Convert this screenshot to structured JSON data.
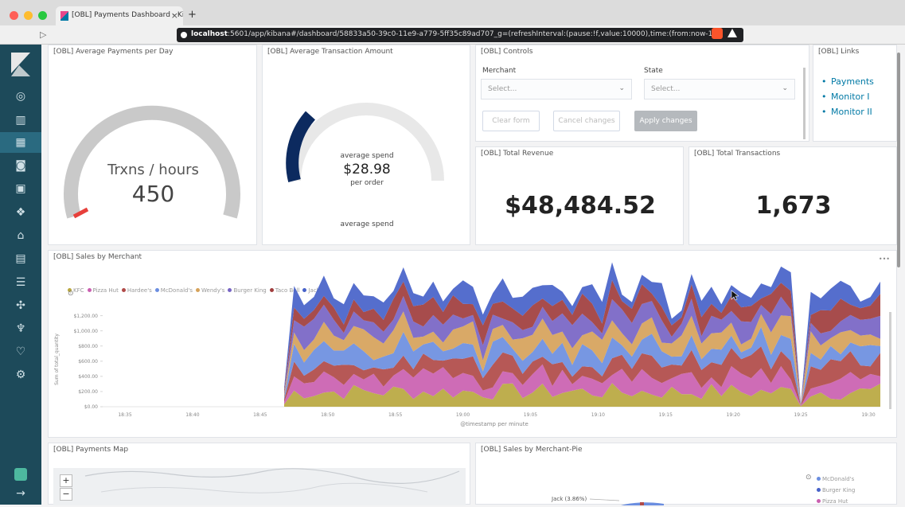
{
  "browser": {
    "tab_title": "[OBL] Payments Dashboard - Ki",
    "url_host": "localhost",
    "url_rest": ":5601/app/kibana#/dashboard/58833a50-39c0-11e9-a779-5ff35c89ad707_g=(refreshInterval:(pause:!f,value:10000),time:(from:now-1...",
    "tab_close": "×",
    "new_tab": "+",
    "back": "▷"
  },
  "panels": {
    "avg_payments": {
      "title": "[OBL] Average Payments per Day",
      "label": "Trxns / hours",
      "value": "450",
      "gauge_fraction": 0.0
    },
    "avg_txn": {
      "title": "[OBL] Average Transaction Amount",
      "top_label": "average spend",
      "value": "$28.98",
      "sub_label": "per order",
      "bottom_label": "average spend",
      "gauge_fraction": 0.12
    },
    "controls": {
      "title": "[OBL] Controls",
      "merchant_label": "Merchant",
      "merchant_placeholder": "Select...",
      "state_label": "State",
      "state_placeholder": "Select...",
      "clear_btn": "Clear form",
      "cancel_btn": "Cancel changes",
      "apply_btn": "Apply changes"
    },
    "links": {
      "title": "[OBL] Links",
      "items": [
        "Payments",
        "Monitor I",
        "Monitor II"
      ]
    },
    "total_revenue": {
      "title": "[OBL] Total Revenue",
      "value": "$48,484.52"
    },
    "total_txns": {
      "title": "[OBL] Total Transactions",
      "value": "1,673"
    },
    "sales_by_merchant": {
      "title": "[OBL] Sales by Merchant",
      "menu": "•••"
    },
    "payments_map": {
      "title": "[OBL] Payments Map",
      "zoom_in": "+",
      "zoom_out": "−"
    },
    "sales_pie": {
      "title": "[OBL] Sales by Merchant-Pie",
      "slice_label": "Jack (3.86%)",
      "legend": [
        "McDonald's",
        "Burger King",
        "Pizza Hut"
      ]
    }
  },
  "chart_data": {
    "type": "area",
    "stacked": true,
    "xlabel": "@timestamp per minute",
    "ylabel": "Sum of total_quantity",
    "x_ticks": [
      "18:35",
      "18:40",
      "18:45",
      "18:50",
      "18:55",
      "19:00",
      "19:05",
      "19:10",
      "19:15",
      "19:20",
      "19:25",
      "19:30"
    ],
    "y_ticks": [
      "$0.00",
      "$200.00",
      "$400.00",
      "$600.00",
      "$800.00",
      "$1,000.00",
      "$1,200.00"
    ],
    "ylim": [
      0,
      1250
    ],
    "legend_position": "top-left",
    "series": [
      {
        "name": "KFC",
        "color": "#b9a73f"
      },
      {
        "name": "Pizza Hut",
        "color": "#ca5fb0"
      },
      {
        "name": "Hardee's",
        "color": "#b04a48"
      },
      {
        "name": "McDonald's",
        "color": "#6b8ee0"
      },
      {
        "name": "Wendy's",
        "color": "#d6a25a"
      },
      {
        "name": "Burger King",
        "color": "#7764c4"
      },
      {
        "name": "Taco Bell",
        "color": "#a03d3d"
      },
      {
        "name": "Jack",
        "color": "#4762c9"
      }
    ]
  },
  "colors": {
    "sidenav": "#1d4a5a",
    "accent": "#0079a5",
    "gauge_red": "#e7403b",
    "gauge_blue": "#0c2a5f"
  }
}
